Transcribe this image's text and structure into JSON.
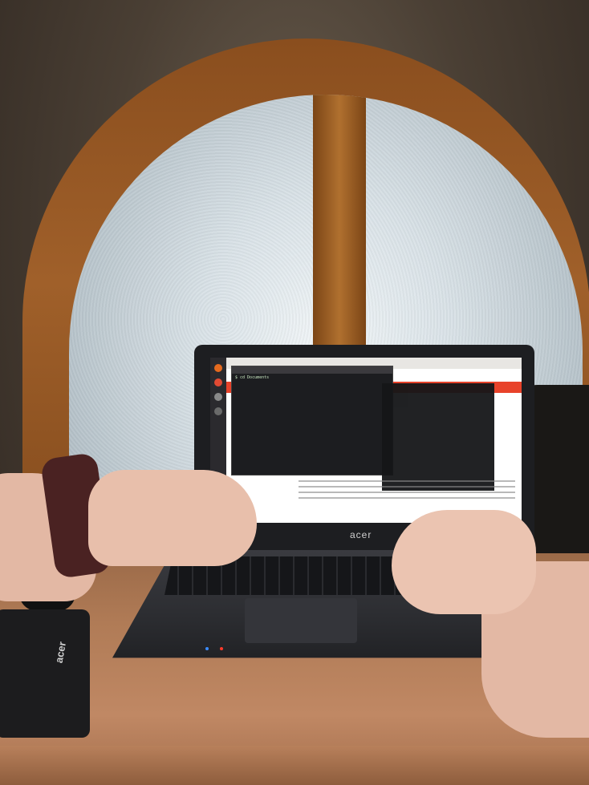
{
  "scene": {
    "laptop_brand": "acer",
    "charger_brand": "acer",
    "terminal_prompt": "$ cd Documents"
  },
  "colors": {
    "glass": "#d9e2e7",
    "wood_frame": "#a0602a",
    "desk": "#b07b56",
    "screen_accent": "#e8422a",
    "terminal_bg": "#1c1d20"
  }
}
